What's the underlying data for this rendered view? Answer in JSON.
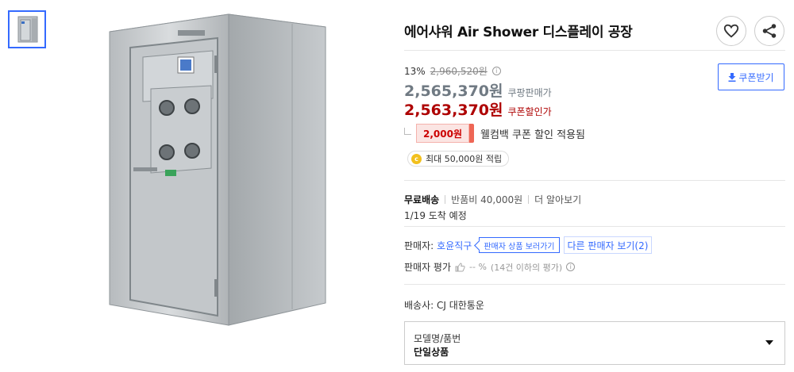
{
  "product": {
    "title": "에어샤워 Air Shower 디스플레이 공장",
    "discount_percent": "13%",
    "original_price": "2,960,520원",
    "price": "2,565,370원",
    "price_label": "쿠팡판매가",
    "coupon_price": "2,563,370원",
    "coupon_price_label": "쿠폰할인가",
    "coupon_download_label": "쿠폰받기",
    "welcome_coupon_amount": "2,000원",
    "welcome_coupon_text": "웰컴백 쿠폰 할인 적용됨",
    "points_text": "최대 50,000원 적립",
    "points_icon": "coin-icon"
  },
  "shipping": {
    "free_label": "무료배송",
    "return_fee": "반품비 40,000원",
    "more_link": "더 알아보기",
    "arrival": "1/19 도착 예정"
  },
  "seller": {
    "label": "판매자:",
    "name": "호윤직구",
    "view_products": "판매자 상품 보러가기",
    "other_sellers": "다른 판매자 보기(2)",
    "rating_label": "판매자 평가",
    "rating_value": "-- %",
    "rating_note": "(14건 이하의 평가)"
  },
  "delivery": {
    "carrier": "배송사: CJ 대한통운"
  },
  "option": {
    "label": "모델명/품번",
    "value": "단일상품"
  },
  "icons": {
    "wishlist": "heart-icon",
    "share": "share-icon",
    "download": "download-icon",
    "info": "info-icon",
    "thumbs": "thumbs-up-icon",
    "dropdown": "caret-down-icon"
  },
  "colors": {
    "accent": "#346aff",
    "sale_red": "#ae0000",
    "price_gray": "#707a83"
  }
}
